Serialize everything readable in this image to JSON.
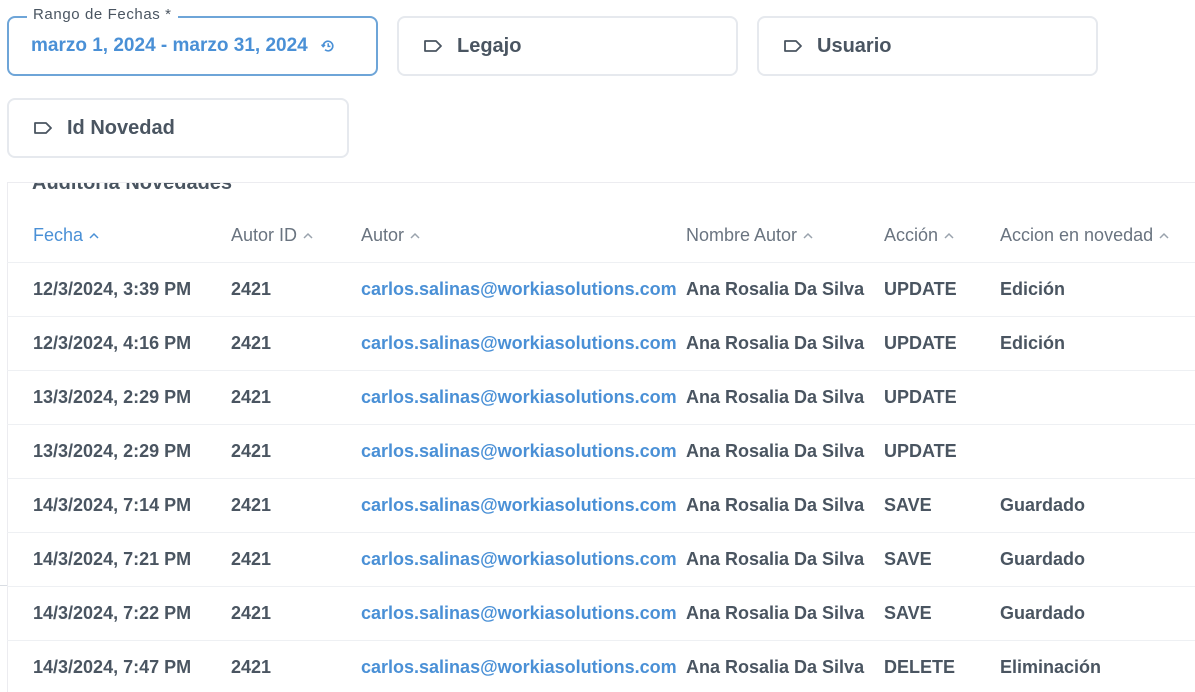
{
  "filters": {
    "date_range": {
      "legend": "Rango de Fechas *",
      "value": "marzo 1, 2024 - marzo 31, 2024",
      "icon": "reset-history-icon"
    },
    "legajo": {
      "label": "Legajo",
      "icon": "tag-icon"
    },
    "usuario": {
      "label": "Usuario",
      "icon": "tag-icon"
    },
    "id_novedad": {
      "label": "Id Novedad",
      "icon": "tag-icon"
    }
  },
  "table": {
    "title": "Auditoria Novedades",
    "columns": [
      {
        "label": "Fecha",
        "active": true
      },
      {
        "label": "Autor ID",
        "active": false
      },
      {
        "label": "Autor",
        "active": false
      },
      {
        "label": "Nombre Autor",
        "active": false
      },
      {
        "label": "Acción",
        "active": false
      },
      {
        "label": "Accion en novedad",
        "active": false
      }
    ],
    "rows": [
      [
        "12/3/2024, 3:39 PM",
        "2421",
        "carlos.salinas@workiasolutions.com",
        "Ana Rosalia Da Silva",
        "UPDATE",
        "Edición"
      ],
      [
        "12/3/2024, 4:16 PM",
        "2421",
        "carlos.salinas@workiasolutions.com",
        "Ana Rosalia Da Silva",
        "UPDATE",
        "Edición"
      ],
      [
        "13/3/2024, 2:29 PM",
        "2421",
        "carlos.salinas@workiasolutions.com",
        "Ana Rosalia Da Silva",
        "UPDATE",
        ""
      ],
      [
        "13/3/2024, 2:29 PM",
        "2421",
        "carlos.salinas@workiasolutions.com",
        "Ana Rosalia Da Silva",
        "UPDATE",
        ""
      ],
      [
        "14/3/2024, 7:14 PM",
        "2421",
        "carlos.salinas@workiasolutions.com",
        "Ana Rosalia Da Silva",
        "SAVE",
        "Guardado"
      ],
      [
        "14/3/2024, 7:21 PM",
        "2421",
        "carlos.salinas@workiasolutions.com",
        "Ana Rosalia Da Silva",
        "SAVE",
        "Guardado"
      ],
      [
        "14/3/2024, 7:22 PM",
        "2421",
        "carlos.salinas@workiasolutions.com",
        "Ana Rosalia Da Silva",
        "SAVE",
        "Guardado"
      ],
      [
        "14/3/2024, 7:47 PM",
        "2421",
        "carlos.salinas@workiasolutions.com",
        "Ana Rosalia Da Silva",
        "DELETE",
        "Eliminación"
      ]
    ]
  },
  "colors": {
    "accent": "#4a90d6",
    "text": "#4a5561",
    "header_text": "#6a7480",
    "border": "#e6e9ee"
  }
}
